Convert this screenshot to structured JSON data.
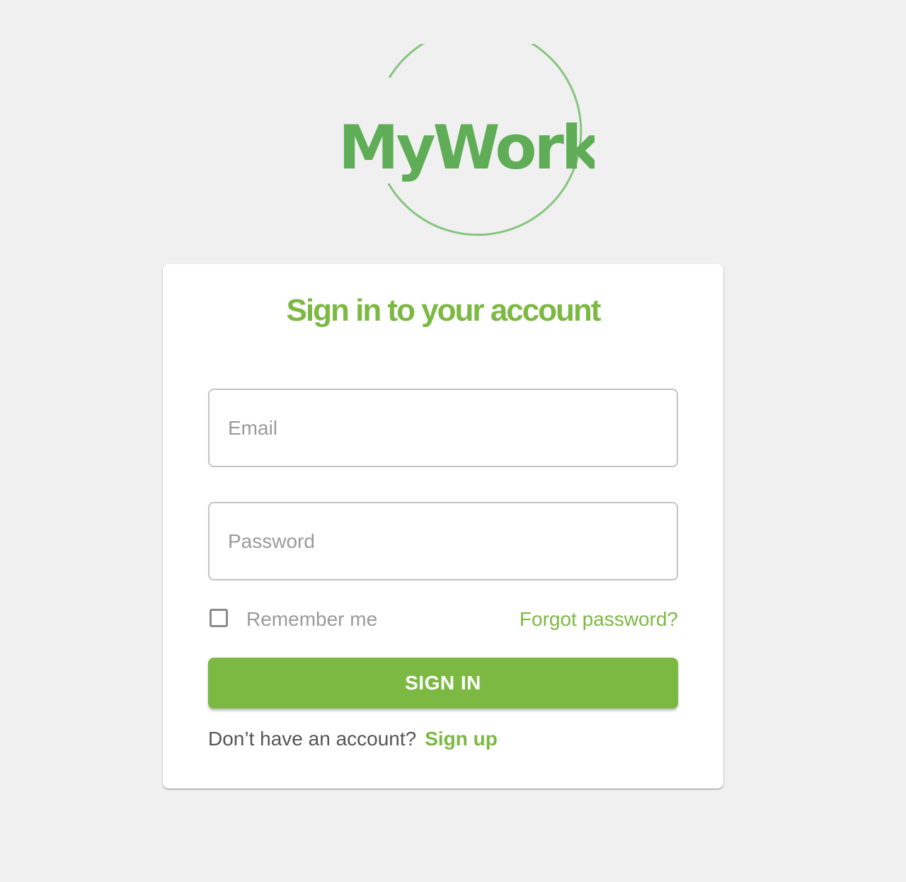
{
  "brand": {
    "logo_text": "MyWork",
    "logo_color": "#5fad56",
    "ring_color": "#86c57f"
  },
  "login": {
    "title": "Sign in to your account",
    "email_placeholder": "Email",
    "password_placeholder": "Password",
    "remember_label": "Remember me",
    "remember_checked": false,
    "forgot_label": "Forgot password?",
    "submit_label": "SIGN IN",
    "signup_prompt": "Don’t have an account?",
    "signup_label": "Sign up"
  },
  "colors": {
    "accent": "#7cb943",
    "background": "#f0f0f0",
    "card": "#ffffff"
  }
}
